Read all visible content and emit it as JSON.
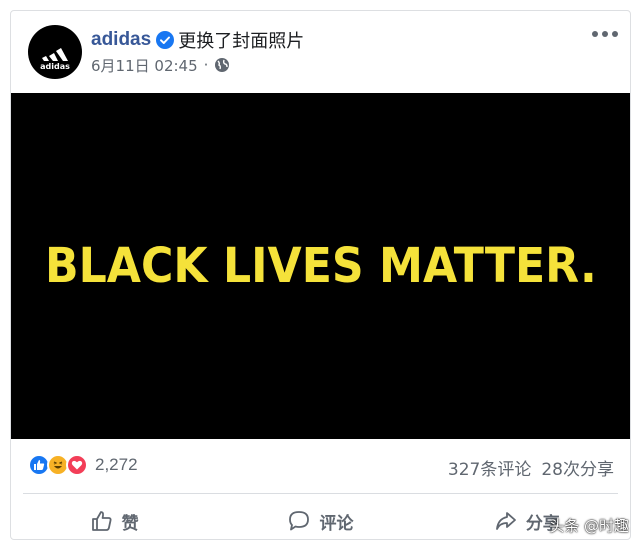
{
  "post": {
    "author": "adidas",
    "action": "更换了封面照片",
    "date": "6月11日 02:45",
    "meta_separator": "·"
  },
  "cover": {
    "text": "BLACK LIVES MATTER.",
    "background": "#000000",
    "text_color": "#f5e23a"
  },
  "stats": {
    "reaction_count": "2,272",
    "comments": "327条评论",
    "shares": "28次分享",
    "reaction_icons": [
      "like-icon",
      "haha-icon",
      "love-icon"
    ]
  },
  "actions": {
    "like": "赞",
    "comment": "评论",
    "share": "分享"
  },
  "watermark": "头条 @时趣",
  "colors": {
    "link_blue": "#385898",
    "verified_blue": "#1877f2",
    "muted_text": "#606770"
  }
}
